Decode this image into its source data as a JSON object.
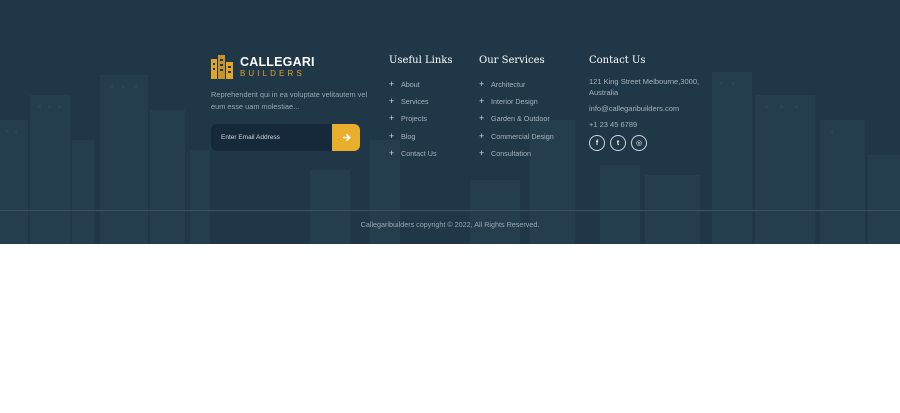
{
  "brand": {
    "name": "CALLEGARI",
    "sub": "BUILDERS",
    "accent": "#e0a52a"
  },
  "about": {
    "text": "Reprehenderit qui in ea voluptate velitautem vel eum esse uam molestiae..."
  },
  "subscribe": {
    "placeholder": "Enter Email Address",
    "button_icon": "arrow-right-icon"
  },
  "useful_links": {
    "title": "Useful Links",
    "items": [
      "About",
      "Services",
      "Projects",
      "Blog",
      "Contact Us"
    ]
  },
  "services": {
    "title": "Our Services",
    "items": [
      "Architectur",
      "Interior Design",
      "Garden & Outdoor",
      "Commercial Design",
      "Consultation"
    ]
  },
  "contact": {
    "title": "Contact Us",
    "address": "121 King Street Melbourne,3000, Australia",
    "email": "info@callegaribuilders.com",
    "phone": "+1 23 45 6789",
    "social": [
      {
        "icon": "facebook-icon",
        "glyph": "f"
      },
      {
        "icon": "twitter-icon",
        "glyph": "t"
      },
      {
        "icon": "instagram-icon",
        "glyph": "◎"
      }
    ]
  },
  "colors": {
    "footer_bg": "#1f3747",
    "button": "#e8ae2c"
  },
  "copyright": "Callegaribuilders copyright © 2022, All Rights Reserved."
}
